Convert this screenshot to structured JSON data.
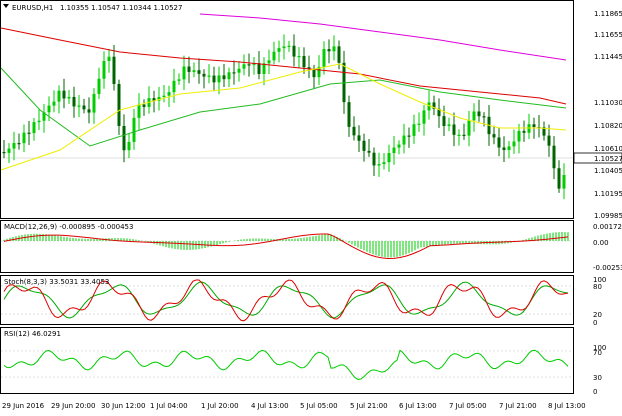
{
  "symbol_header": {
    "symbol": "EURUSD,H1",
    "ohlc": "1.10355 1.10547 1.10344 1.10527"
  },
  "price_axis": {
    "labels": [
      "1.11865",
      "1.11655",
      "1.11445",
      "1.11030",
      "1.10820",
      "1.10610",
      "1.10405",
      "1.10195",
      "1.09985"
    ],
    "current": "1.10527"
  },
  "macd": {
    "label": "MACD(12,26,9) -0.000895 -0.000453",
    "axis": [
      "0.001724",
      "0.00",
      "-0.00253"
    ]
  },
  "stoch": {
    "label": "Stoch(8,3,3) 33.5031 33.4053",
    "axis": [
      "100",
      "80",
      "20",
      "0"
    ]
  },
  "rsi": {
    "label": "RSI(12) 46.0291",
    "axis": [
      "100",
      "70",
      "30",
      "0"
    ]
  },
  "time_axis": [
    "29 Jun 2016",
    "29 Jun 20:00",
    "30 Jun 12:00",
    "1 Jul 04:00",
    "1 Jul 20:00",
    "4 Jul 13:00",
    "5 Jul 05:00",
    "5 Jul 21:00",
    "6 Jul 13:00",
    "7 Jul 05:00",
    "7 Jul 21:00",
    "8 Jul 13:00"
  ],
  "colors": {
    "bull": "#00cc00",
    "bear": "#006400",
    "ma_slow": "#dd0000",
    "ma_long": "#dd00dd",
    "ma_mid": "#22bb22",
    "ma_fast": "#eeee00",
    "macd_signal": "#dd0000",
    "stoch_main": "#dd0000",
    "stoch_signal": "#00aa00",
    "rsi_line": "#00cc00",
    "grid": "#c0c0c0"
  }
}
